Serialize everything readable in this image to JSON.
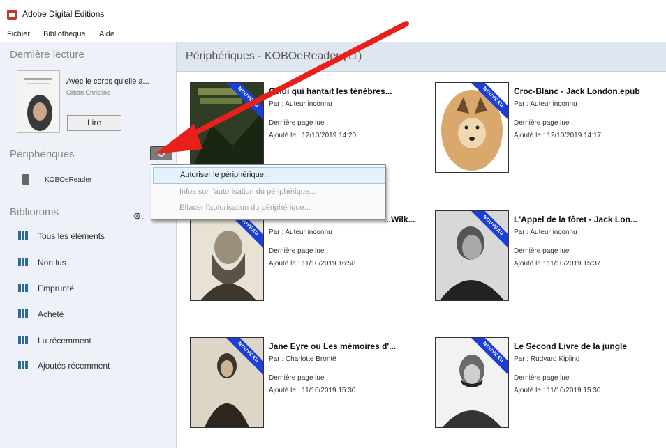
{
  "app": {
    "title": "Adobe Digital Editions"
  },
  "menu": [
    "Fichier",
    "Bibliothèque",
    "Aide"
  ],
  "sidebar": {
    "last_read": {
      "heading": "Dernière lecture",
      "title": "Avec le corps qu'elle a...",
      "author": "Orban Christine",
      "read_label": "Lire"
    },
    "devices": {
      "heading": "Périphériques",
      "items": [
        {
          "label": "KOBOeReader"
        }
      ]
    },
    "bibliorooms": {
      "heading": "Biblioroms",
      "items": [
        {
          "label": "Tous les éléments"
        },
        {
          "label": "Non lus"
        },
        {
          "label": "Emprunté"
        },
        {
          "label": "Acheté"
        },
        {
          "label": "Lu récemment"
        },
        {
          "label": "Ajoutés récemment"
        }
      ]
    }
  },
  "content": {
    "header": "Périphériques - KOBOeReader (11)",
    "badge": "NOUVEAU",
    "books": [
      {
        "title": "Celui qui hantait les ténèbres...",
        "author": "Par : Auteur inconnu",
        "last_page": "Dernière page lue :",
        "added": "Ajouté le : 12/10/2019 14:20"
      },
      {
        "title": "Croc-Blanc - Jack London.epub",
        "author": "Par : Auteur inconnu",
        "last_page": "Dernière page lue :",
        "added": "Ajouté le : 12/10/2019 14:17"
      },
      {
        "title": "...Wilk...",
        "author": "Par : Auteur inconnu",
        "last_page": "Dernière page lue :",
        "added": "Ajouté le : 11/10/2019 16:58"
      },
      {
        "title": "L'Appel de la fôret - Jack Lon...",
        "author": "Par : Auteur inconnu",
        "last_page": "Dernière page lue :",
        "added": "Ajouté le : 11/10/2019 15:37"
      },
      {
        "title": "Jane Eyre ou Les mémoires d'...",
        "author": "Par : Charlotte Brontë",
        "last_page": "Dernière page lue :",
        "added": "Ajouté le : 11/10/2019 15:30"
      },
      {
        "title": "Le Second Livre de la jungle",
        "author": "Par : Rudyard Kipling",
        "last_page": "Dernière page lue :",
        "added": "Ajouté le : 11/10/2019 15:30"
      }
    ]
  },
  "context_menu": {
    "items": [
      {
        "label": "Autoriser le périphérique...",
        "state": "active"
      },
      {
        "label": "Infos sur l'autorisation du périphérique...",
        "state": "disabled"
      },
      {
        "label": "Effacer l'autorisation du périphérique...",
        "state": "disabled"
      }
    ]
  },
  "colors": {
    "ribbon": "#1c3fd6",
    "arrow": "#e8201c",
    "sidebar_bg": "#eef2f8",
    "header_bg": "#dfe6f0"
  },
  "icons": [
    "app-logo-icon",
    "gear-icon",
    "device-icon",
    "bookshelf-icon",
    "red-arrow-annotation"
  ]
}
